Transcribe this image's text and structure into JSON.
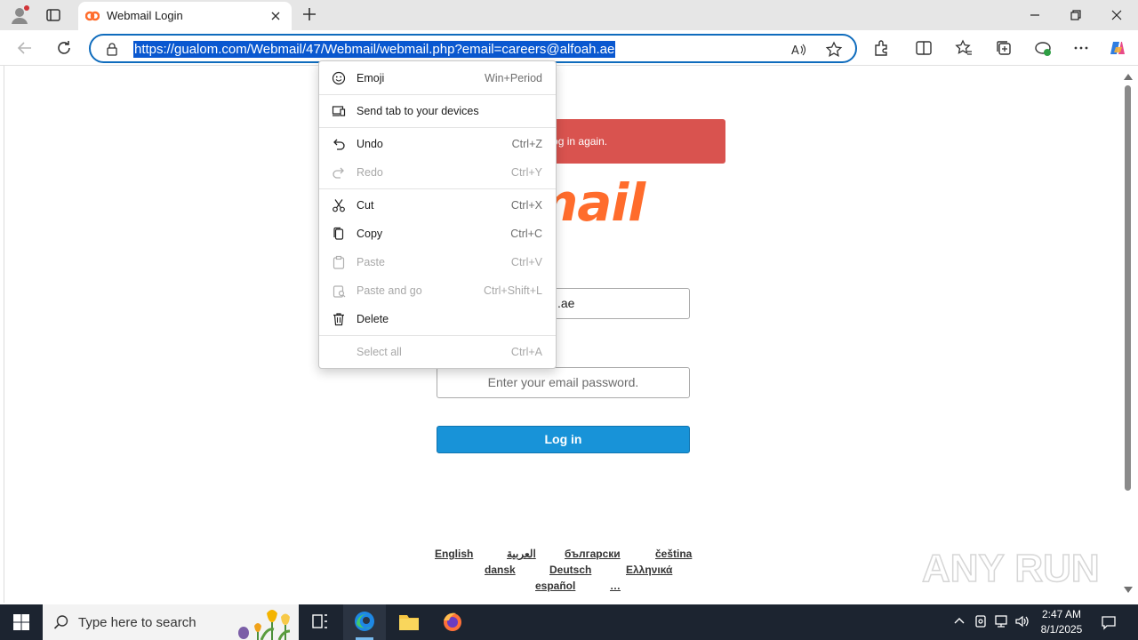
{
  "browser": {
    "tab_title": "Webmail Login",
    "url": "https://gualom.com/Webmail/47/Webmail/webmail.php?email=careers@alfoah.ae",
    "accent_color": "#0f6cbd"
  },
  "page": {
    "alert_text": "valid. Please log in again.",
    "logo_text": "omail",
    "email_value_visible": ".ae",
    "password_placeholder": "Enter your email password.",
    "login_label": "Log in",
    "languages": [
      "English",
      "العربية",
      "български",
      "čeština",
      "dansk",
      "Deutsch",
      "Ελληνικά",
      "español",
      "…"
    ],
    "alert_color": "#d9534f",
    "button_color": "#1893d8",
    "logo_color": "#ff6c2c"
  },
  "context_menu": {
    "items": [
      {
        "label": "Emoji",
        "shortcut": "Win+Period",
        "icon": "emoji-icon",
        "disabled": false
      },
      {
        "label": "Send tab to your devices",
        "shortcut": "",
        "icon": "send-tab-icon",
        "disabled": false
      },
      {
        "label": "Undo",
        "shortcut": "Ctrl+Z",
        "icon": "undo-icon",
        "disabled": false
      },
      {
        "label": "Redo",
        "shortcut": "Ctrl+Y",
        "icon": "redo-icon",
        "disabled": true
      },
      {
        "label": "Cut",
        "shortcut": "Ctrl+X",
        "icon": "cut-icon",
        "disabled": false
      },
      {
        "label": "Copy",
        "shortcut": "Ctrl+C",
        "icon": "copy-icon",
        "disabled": false
      },
      {
        "label": "Paste",
        "shortcut": "Ctrl+V",
        "icon": "paste-icon",
        "disabled": true
      },
      {
        "label": "Paste and go",
        "shortcut": "Ctrl+Shift+L",
        "icon": "paste-go-icon",
        "disabled": true
      },
      {
        "label": "Delete",
        "shortcut": "",
        "icon": "delete-icon",
        "disabled": false
      },
      {
        "label": "Select all",
        "shortcut": "Ctrl+A",
        "icon": "",
        "disabled": true
      }
    ]
  },
  "taskbar": {
    "search_placeholder": "Type here to search",
    "time": "2:47 AM",
    "date": "8/1/2025"
  },
  "watermark": "ANY RUN"
}
